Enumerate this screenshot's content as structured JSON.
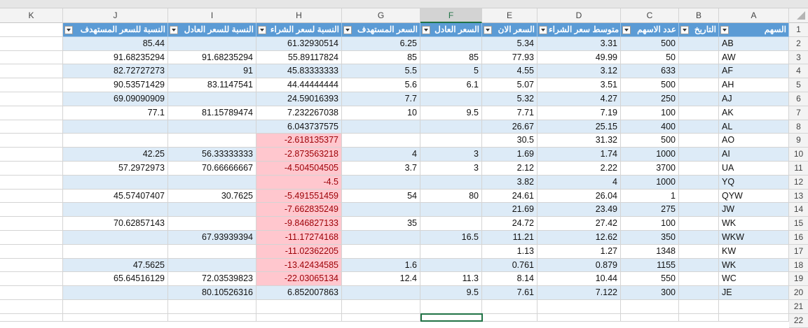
{
  "columns": [
    "K",
    "J",
    "I",
    "H",
    "G",
    "F",
    "E",
    "D",
    "C",
    "B",
    "A"
  ],
  "selected_column": "F",
  "headers": {
    "A": "السهم",
    "B": "التاريخ",
    "C": "عدد الاسهم",
    "D": "متوسط سعر الشراء",
    "E": "السعر الان",
    "F": "السعر العادل",
    "G": "السعر المستهدف",
    "H": "النسبة لسعر الشراء",
    "I": "النسبة للسعر العادل",
    "J": "النسبة للسعر المستهدف"
  },
  "row_numbers": [
    "1",
    "2",
    "3",
    "4",
    "5",
    "6",
    "7",
    "8",
    "9",
    "10",
    "11",
    "12",
    "13",
    "14",
    "15",
    "16",
    "17",
    "18",
    "19",
    "20",
    "21",
    "22"
  ],
  "rows": [
    {
      "A": "AB",
      "C": "500",
      "D": "3.31",
      "E": "5.34",
      "F": "",
      "G": "6.25",
      "H": "61.32930514",
      "I": "",
      "J": "85.44"
    },
    {
      "A": "AW",
      "C": "50",
      "D": "49.99",
      "E": "77.93",
      "F": "85",
      "G": "85",
      "H": "55.89117824",
      "I": "91.68235294",
      "J": "91.68235294"
    },
    {
      "A": "AF",
      "C": "633",
      "D": "3.12",
      "E": "4.55",
      "F": "5",
      "G": "5.5",
      "H": "45.83333333",
      "I": "91",
      "J": "82.72727273"
    },
    {
      "A": "AH",
      "C": "500",
      "D": "3.51",
      "E": "5.07",
      "F": "6.1",
      "G": "5.6",
      "H": "44.44444444",
      "I": "83.1147541",
      "J": "90.53571429"
    },
    {
      "A": "AJ",
      "C": "250",
      "D": "4.27",
      "E": "5.32",
      "F": "",
      "G": "7.7",
      "H": "24.59016393",
      "I": "",
      "J": "69.09090909"
    },
    {
      "A": "AK",
      "C": "100",
      "D": "7.19",
      "E": "7.71",
      "F": "9.5",
      "G": "10",
      "H": "7.232267038",
      "I": "81.15789474",
      "J": "77.1"
    },
    {
      "A": "AL",
      "C": "400",
      "D": "25.15",
      "E": "26.67",
      "F": "",
      "G": "",
      "H": "6.043737575",
      "I": "",
      "J": ""
    },
    {
      "A": "AO",
      "C": "500",
      "D": "31.32",
      "E": "30.5",
      "F": "",
      "G": "",
      "H": "-2.618135377",
      "I": "",
      "J": ""
    },
    {
      "A": "AI",
      "C": "1000",
      "D": "1.74",
      "E": "1.69",
      "F": "3",
      "G": "4",
      "H": "-2.873563218",
      "I": "56.33333333",
      "J": "42.25"
    },
    {
      "A": "UA",
      "C": "3700",
      "D": "2.22",
      "E": "2.12",
      "F": "3",
      "G": "3.7",
      "H": "-4.504504505",
      "I": "70.66666667",
      "J": "57.2972973"
    },
    {
      "A": "YQ",
      "C": "1000",
      "D": "4",
      "E": "3.82",
      "F": "",
      "G": "",
      "H": "-4.5",
      "I": "",
      "J": ""
    },
    {
      "A": "QYW",
      "C": "1",
      "D": "26.04",
      "E": "24.61",
      "F": "80",
      "G": "54",
      "H": "-5.491551459",
      "I": "30.7625",
      "J": "45.57407407"
    },
    {
      "A": "JW",
      "C": "275",
      "D": "23.49",
      "E": "21.69",
      "F": "",
      "G": "",
      "H": "-7.662835249",
      "I": "",
      "J": ""
    },
    {
      "A": "WK",
      "C": "100",
      "D": "27.42",
      "E": "24.72",
      "F": "",
      "G": "35",
      "H": "-9.846827133",
      "I": "",
      "J": "70.62857143"
    },
    {
      "A": "WKW",
      "C": "350",
      "D": "12.62",
      "E": "11.21",
      "F": "16.5",
      "G": "",
      "H": "-11.17274168",
      "I": "67.93939394",
      "J": ""
    },
    {
      "A": "KW",
      "C": "1348",
      "D": "1.27",
      "E": "1.13",
      "F": "",
      "G": "",
      "H": "-11.02362205",
      "I": "",
      "J": ""
    },
    {
      "A": "WK",
      "C": "1155",
      "D": "0.879",
      "E": "0.761",
      "F": "",
      "G": "1.6",
      "H": "-13.42434585",
      "I": "",
      "J": "47.5625"
    },
    {
      "A": "WC",
      "C": "550",
      "D": "10.44",
      "E": "8.14",
      "F": "11.3",
      "G": "12.4",
      "H": "-22.03065134",
      "I": "72.03539823",
      "J": "65.64516129"
    },
    {
      "A": "JE",
      "C": "300",
      "D": "7.122",
      "E": "7.61",
      "F": "9.5",
      "G": "",
      "H": "6.852007863",
      "I": "80.10526316",
      "J": ""
    }
  ],
  "colors": {
    "header_fill": "#5b9bd5",
    "band_fill": "#ddebf7",
    "negative_fill": "#ffc7ce",
    "negative_text": "#9c0006",
    "select_green": "#217346"
  },
  "icons": {
    "filter_dropdown": "chevron-down-icon",
    "select_all": "select-all-triangle-icon"
  }
}
